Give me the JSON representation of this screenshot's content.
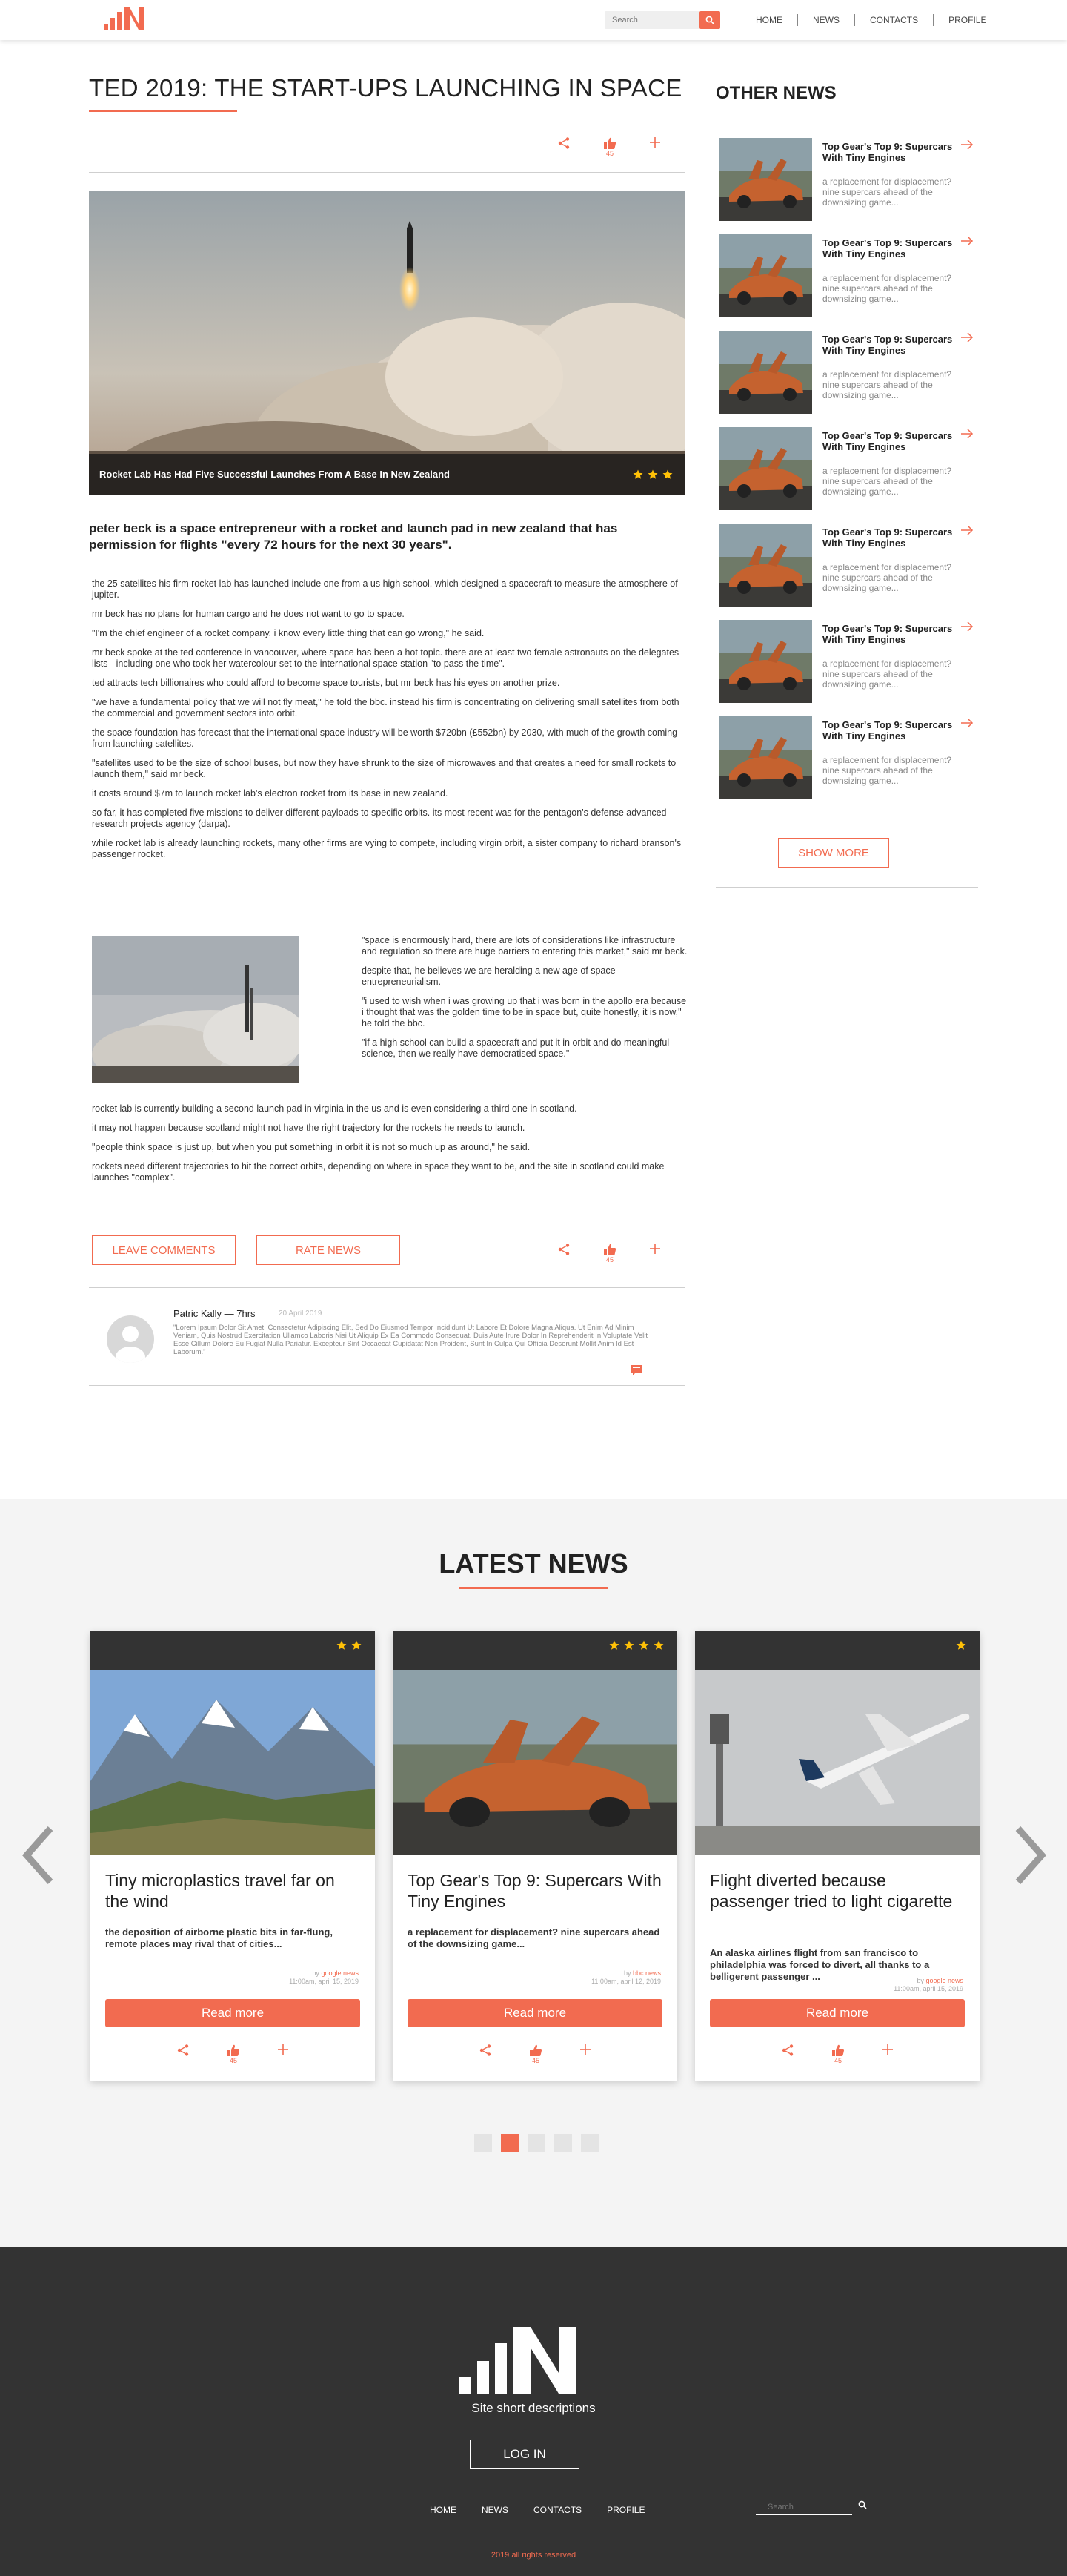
{
  "header": {
    "search_placeholder": "Search",
    "nav": [
      "HOME",
      "NEWS",
      "CONTACTS",
      "PROFILE"
    ]
  },
  "article": {
    "title": "TED 2019: THE START-UPS LAUNCHING IN SPACE",
    "like_count": "45",
    "hero_caption": "Rocket Lab Has Had Five Successful Launches From A Base In New Zealand",
    "hero_rating": 3,
    "lead": "peter beck is a space entrepreneur with a rocket and launch pad in new zealand that has permission for flights \"every 72 hours for the next 30 years\".",
    "paragraphs": [
      "the 25 satellites his firm rocket lab has launched include one from a us high school, which designed a spacecraft to measure the atmosphere of jupiter.",
      "mr beck has no plans for human cargo and he does not want to go to space.",
      "\"I'm the chief engineer of a rocket company. i know every little thing that can go wrong,\" he said.",
      "mr beck spoke at the ted conference in vancouver, where space has been a hot topic. there are at least two female astronauts on the delegates lists - including one who took her watercolour set to the international space station \"to pass the time\".",
      "ted attracts tech billionaires who could afford to become space tourists, but mr beck has his eyes on another prize.",
      "\"we have a fundamental policy that we will not fly meat,\" he told the bbc. instead his firm is concentrating on delivering small satellites from both the commercial and government sectors into orbit.",
      "the space foundation has forecast that the international space industry will be worth $720bn (£552bn) by 2030, with much of the growth coming from launching satellites.",
      "\"satellites used to be the size of school buses, but now they have shrunk to the size of microwaves and that creates a need for small rockets to launch them,\" said mr beck.",
      "it costs around $7m to launch rocket lab's electron rocket from its base in new zealand.",
      "so far, it has completed five missions to deliver different payloads to specific orbits. its most recent was for the pentagon's defense advanced research projects agency (darpa).",
      "while rocket lab is already launching rockets, many other firms are vying to compete, including virgin orbit, a sister company to richard branson's passenger rocket."
    ],
    "side_paragraphs": [
      "\"space is enormously hard, there are lots of considerations like infrastructure and regulation so there are huge barriers to entering this market,\" said mr beck.",
      "despite that, he believes we are heralding a new age of space entrepreneurialism.",
      "\"i used to wish when i was growing up that i was born in the apollo era because i thought that was the golden time to be in space but, quite honestly, it is now,\" he told the bbc.",
      "\"if a high school can build a spacecraft and put it in orbit and do meaningful science, then we really have democratised space.\""
    ],
    "closing_paragraphs": [
      "rocket lab is currently building a second launch pad in virginia in the us and is even considering a third one in scotland.",
      "it may not happen because scotland might not have the right trajectory for the rockets he needs to launch.",
      " \"people think space is just up, but when you put something in orbit it is not so much up as around,\" he said.",
      "rockets need different trajectories to hit the correct orbits, depending on where in space they want to be, and the site in scotland could make launches \"complex\"."
    ],
    "leave_comments": "LEAVE COMMENTS",
    "rate_news": "RATE NEWS"
  },
  "comment": {
    "author": "Patric Kally — 7hrs",
    "date": "20 April 2019",
    "text": "\"Lorem Ipsum Dolor Sit Amet, Consectetur Adipiscing Elit, Sed Do Eiusmod Tempor Incididunt Ut Labore Et Dolore Magna Aliqua. Ut Enim Ad Minim Veniam, Quis Nostrud Exercitation Ullamco Laboris Nisi Ut Aliquip Ex Ea Commodo Consequat. Duis Aute Irure Dolor In Reprehenderit In Voluptate Velit Esse Cillum Dolore Eu Fugiat Nulla Pariatur. Excepteur Sint Occaecat Cupidatat Non Proident, Sunt In Culpa Qui Officia Deserunt Mollit Anim Id Est Laborum.\""
  },
  "sidebar": {
    "title": "OTHER NEWS",
    "items": [
      {
        "title": "Top Gear's Top 9: Supercars With Tiny Engines",
        "desc": "a replacement for displacement? nine supercars ahead of the downsizing game..."
      },
      {
        "title": "Top Gear's Top 9: Supercars With Tiny Engines",
        "desc": "a replacement for displacement? nine supercars ahead of the downsizing game..."
      },
      {
        "title": "Top Gear's Top 9: Supercars With Tiny Engines",
        "desc": "a replacement for displacement? nine supercars ahead of the downsizing game..."
      },
      {
        "title": "Top Gear's Top 9: Supercars With Tiny Engines",
        "desc": "a replacement for displacement? nine supercars ahead of the downsizing game..."
      },
      {
        "title": "Top Gear's Top 9: Supercars With Tiny Engines",
        "desc": "a replacement for displacement? nine supercars ahead of the downsizing game..."
      },
      {
        "title": "Top Gear's Top 9: Supercars With Tiny Engines",
        "desc": "a replacement for displacement? nine supercars ahead of the downsizing game..."
      },
      {
        "title": "Top Gear's Top 9: Supercars With Tiny Engines",
        "desc": "a replacement for displacement? nine supercars ahead of the downsizing game..."
      }
    ],
    "show_more": "SHOW MORE"
  },
  "latest": {
    "title": "LATEST NEWS",
    "read_more": "Read more",
    "cards": [
      {
        "title": "Tiny microplastics travel far on the wind",
        "desc": "the deposition of airborne plastic bits in far-flung, remote places may rival that of cities...",
        "by": "google news",
        "date": "11:00am, april 15, 2019",
        "rating": 2,
        "likes": "45"
      },
      {
        "title": "Top Gear's Top 9: Supercars With Tiny Engines",
        "desc": "a replacement for displacement? nine supercars ahead of the downsizing game...",
        "by": "bbc news",
        "date": "11:00am, april 12, 2019",
        "rating": 4,
        "likes": "45"
      },
      {
        "title": "Flight diverted because passenger tried to light cigarette",
        "desc": "An alaska airlines flight from san francisco to philadelphia was forced to divert, all thanks to a belligerent passenger ...",
        "by": "google news",
        "date": "11:00am, april 15, 2019",
        "rating": 1,
        "likes": "45"
      }
    ],
    "by_prefix": "by",
    "active_page": 2,
    "page_count": 5
  },
  "footer": {
    "description": "Site short descriptions",
    "login": "LOG IN",
    "nav": [
      "HOME",
      "NEWS",
      "CONTACTS",
      "PROFILE"
    ],
    "search_placeholder": "Search",
    "copyright": "2019 all rights reserved"
  },
  "colors": {
    "accent": "#f26b50",
    "dark": "#333333",
    "light_bg": "#f4f4f4"
  }
}
